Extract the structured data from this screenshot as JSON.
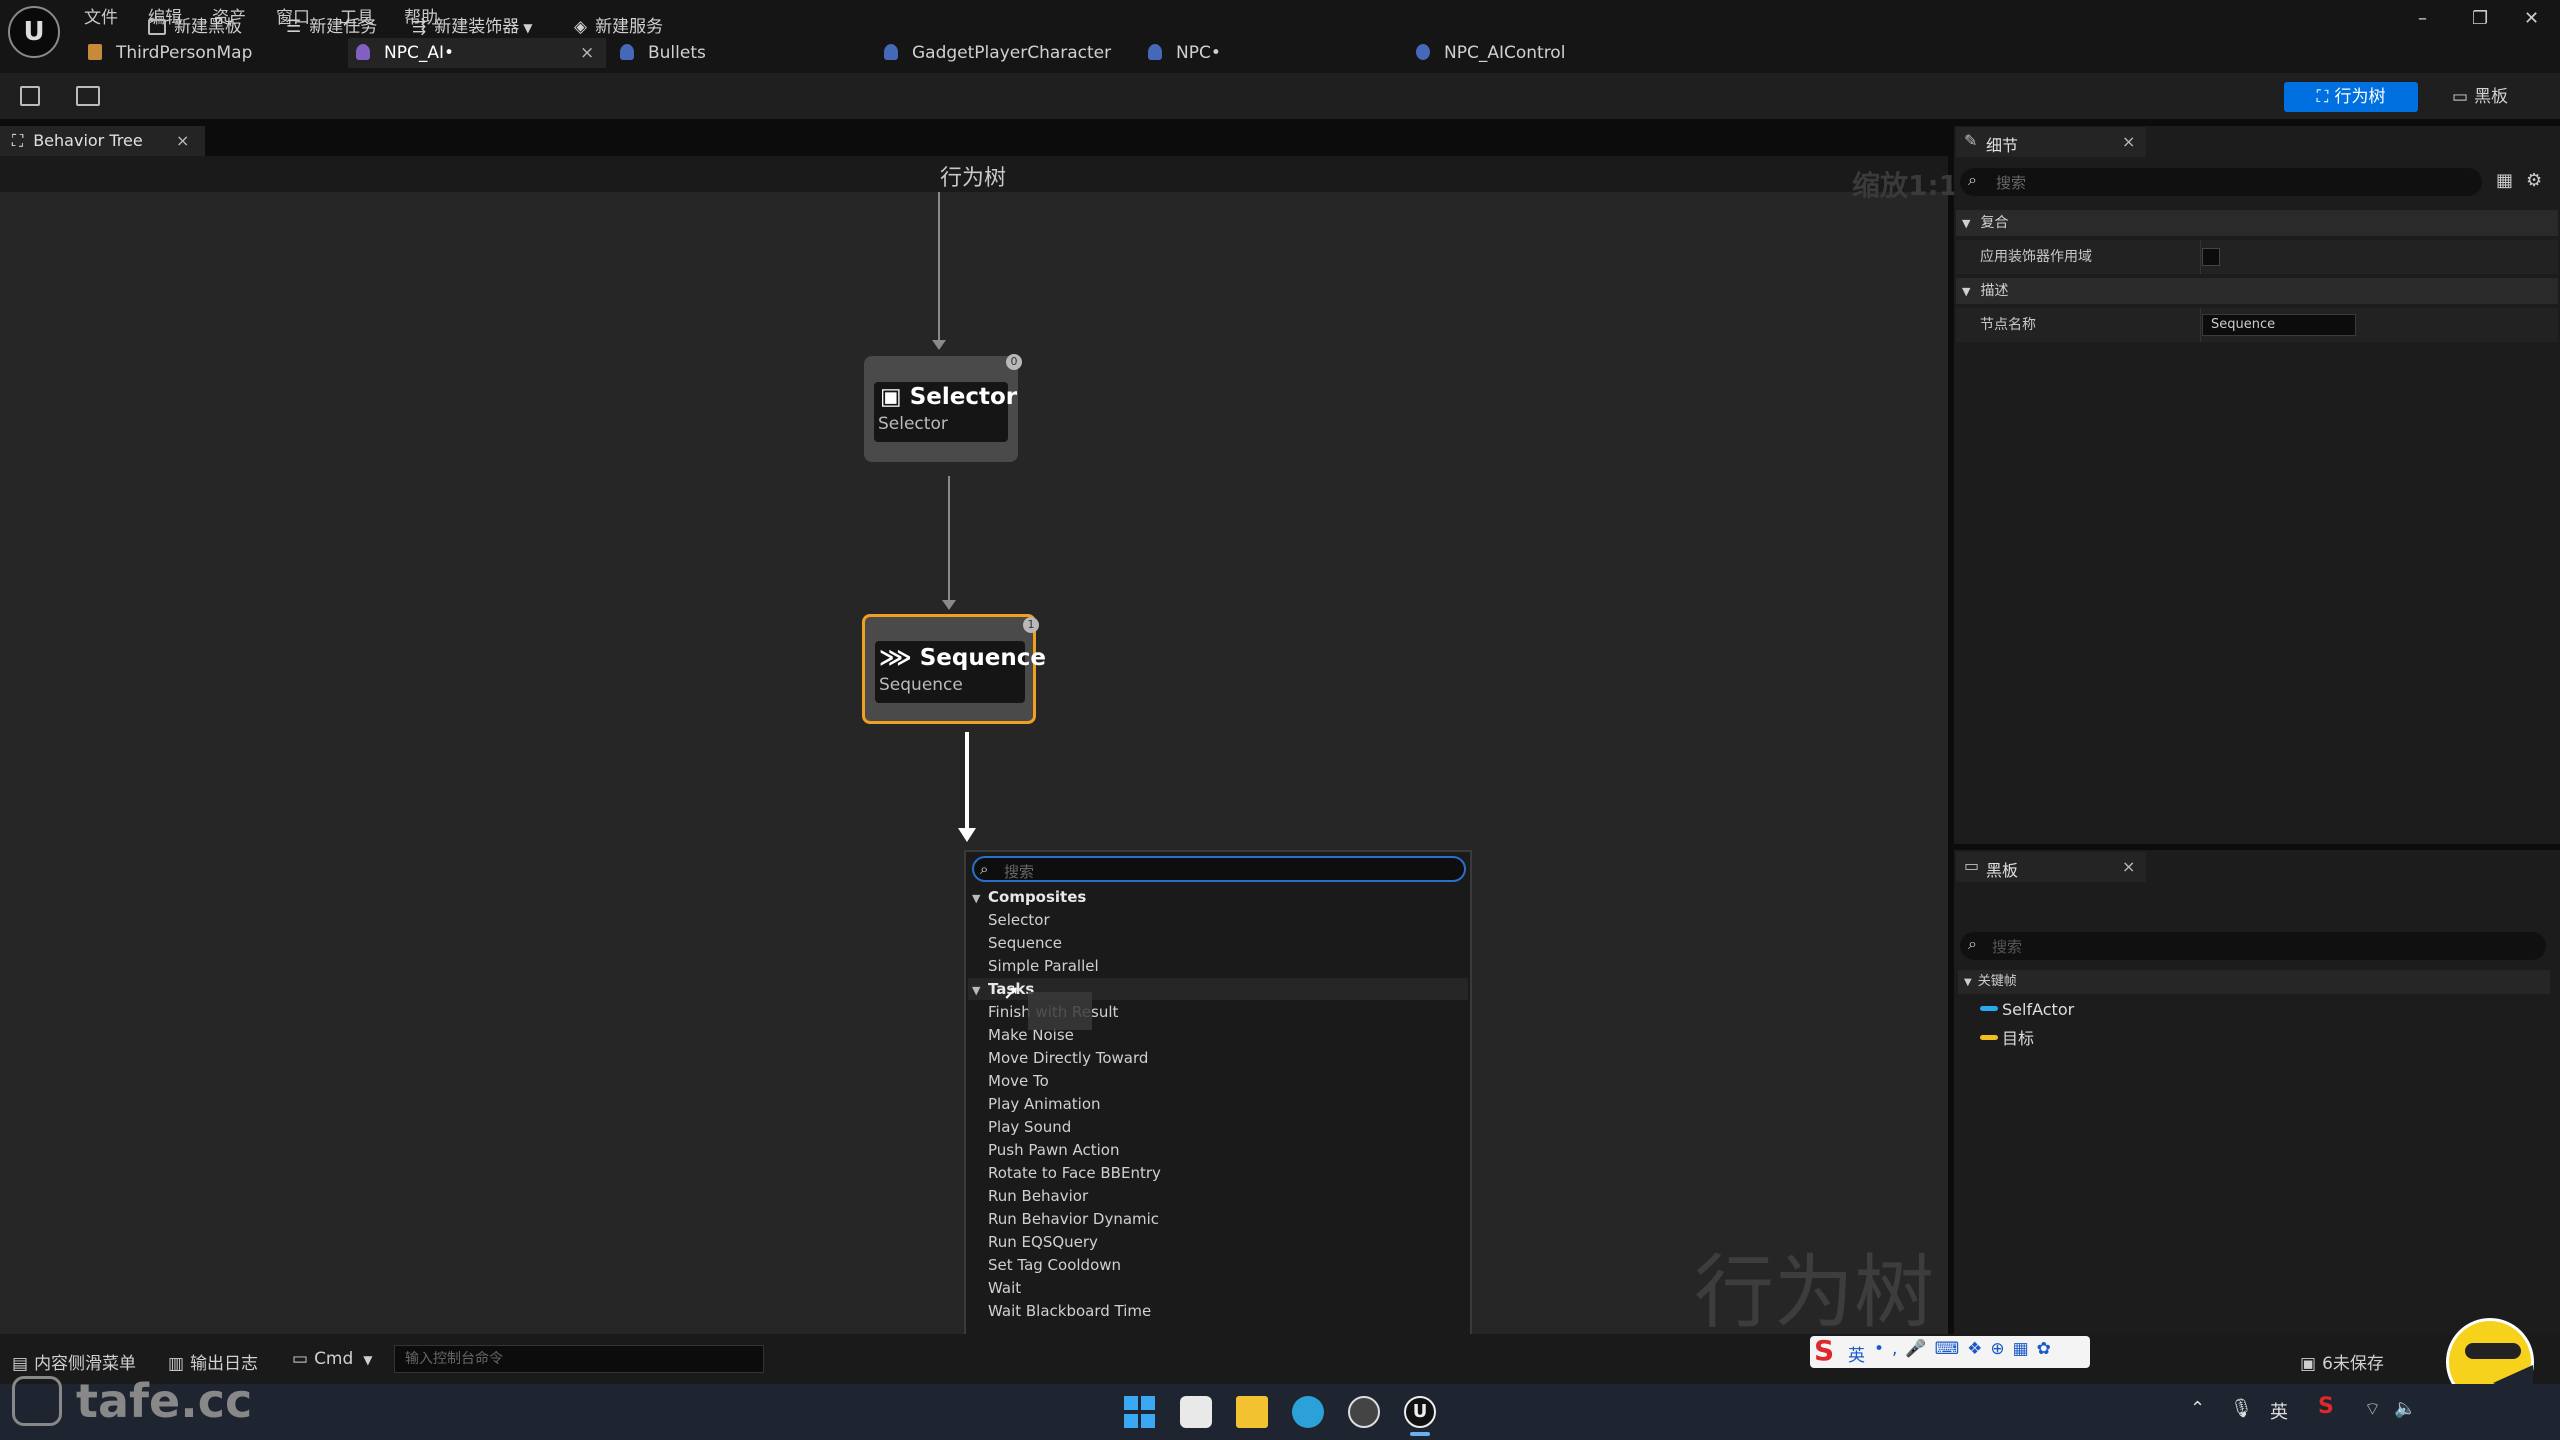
{
  "menu": [
    "文件",
    "编辑",
    "资产",
    "窗口",
    "工具",
    "帮助"
  ],
  "tabs": [
    {
      "label": "ThirdPersonMap"
    },
    {
      "label": "NPC_AI•",
      "close": "×"
    },
    {
      "label": "Bullets"
    },
    {
      "label": "GadgetPlayerCharacter"
    },
    {
      "label": "NPC•"
    },
    {
      "label": "NPC_AIControl"
    }
  ],
  "toolbar": {
    "new_blackboard": "新建黑板",
    "new_task": "新建任务",
    "new_decorator": "新建装饰器",
    "new_service": "新建服务",
    "mode_behavior_tree": "行为树",
    "mode_blackboard": "黑板"
  },
  "graph": {
    "tab_label": "Behavior Tree",
    "tab_close": "×",
    "title": "行为树",
    "zoom": "缩放1:1",
    "watermark": "行为树",
    "nodes": [
      {
        "title": "Selector",
        "subtitle": "Selector",
        "badge": "0"
      },
      {
        "title": "Sequence",
        "subtitle": "Sequence",
        "badge": "1"
      }
    ]
  },
  "context_menu": {
    "search_placeholder": "搜索",
    "categories": [
      {
        "label": "Composites",
        "items": [
          "Selector",
          "Sequence",
          "Simple Parallel"
        ]
      },
      {
        "label": "Tasks",
        "items": [
          "Finish with Result",
          "Make Noise",
          "Move Directly Toward",
          "Move To",
          "Play Animation",
          "Play Sound",
          "Push Pawn Action",
          "Rotate to Face BBEntry",
          "Run Behavior",
          "Run Behavior Dynamic",
          "Run EQSQuery",
          "Set Tag Cooldown",
          "Wait",
          "Wait Blackboard Time"
        ]
      }
    ]
  },
  "details": {
    "tab_label": "细节",
    "close": "×",
    "search_placeholder": "搜索",
    "categories": [
      {
        "label": "复合",
        "props": [
          {
            "name": "应用装饰器作用域",
            "value": ""
          }
        ]
      },
      {
        "label": "描述",
        "props": [
          {
            "name": "节点名称",
            "value": "Sequence"
          }
        ]
      }
    ]
  },
  "blackboard": {
    "tab_label": "黑板",
    "close": "×",
    "search_placeholder": "搜索",
    "section": "关键帧",
    "keys": [
      {
        "name": "SelfActor",
        "color": "#2aa8f0"
      },
      {
        "name": "目标",
        "color": "#f0c020"
      }
    ]
  },
  "statusbar": {
    "content_drawer": "内容侧滑菜单",
    "output_log": "输出日志",
    "cmd": "Cmd",
    "console_placeholder": "输入控制台命令",
    "unsaved": "6未保存"
  },
  "ime": {
    "label": "英"
  },
  "branding": {
    "watermark_text": "tafe.cc"
  },
  "tray": {
    "lang": "英"
  },
  "colors": {
    "accent_blue": "#0070e0",
    "selected_node": "#f0a020"
  }
}
